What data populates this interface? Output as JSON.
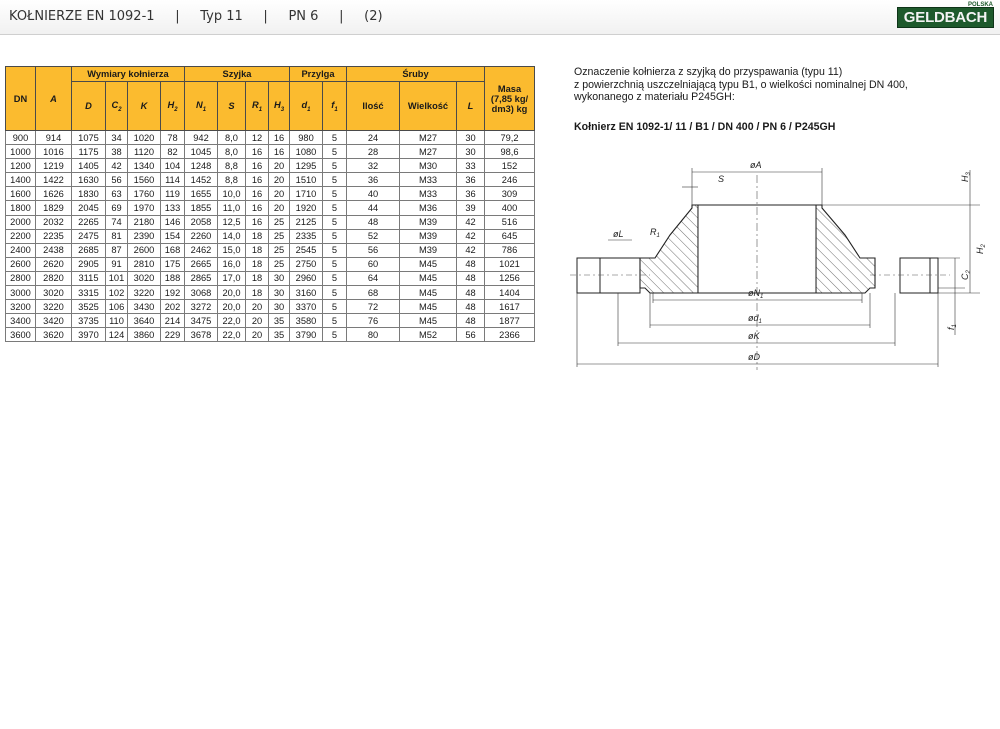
{
  "header": {
    "title": "KOŁNIERZE EN 1092-1     |     Typ 11     |     PN 6     |     (2)",
    "logo_text": "GELDBACH",
    "logo_small": "POLSKA"
  },
  "table": {
    "group_headers": {
      "dn": "DN",
      "flange": "Wymiary kołnierza",
      "neck": "Szyjka",
      "face": "Przylga",
      "bolts": "Śruby",
      "mass": "Masa (7,85 kg/ dm3) kg"
    },
    "symbols": {
      "a": "A",
      "d": "D",
      "c2": "C",
      "c2_sub": "2",
      "k": "K",
      "h2": "H",
      "h2_sub": "2",
      "n1": "N",
      "n1_sub": "1",
      "s": "S",
      "r1": "R",
      "r1_sub": "1",
      "h3": "H",
      "h3_sub": "3",
      "d1": "d",
      "d1_sub": "1",
      "f1": "f",
      "f1_sub": "1",
      "qty": "Ilość",
      "size": "Wielkość",
      "l": "L"
    },
    "rows": [
      [
        "900",
        "914",
        "1075",
        "34",
        "1020",
        "78",
        "942",
        "8,0",
        "12",
        "16",
        "980",
        "5",
        "24",
        "M27",
        "30",
        "79,2"
      ],
      [
        "1000",
        "1016",
        "1175",
        "38",
        "1120",
        "82",
        "1045",
        "8,0",
        "16",
        "16",
        "1080",
        "5",
        "28",
        "M27",
        "30",
        "98,6"
      ],
      [
        "1200",
        "1219",
        "1405",
        "42",
        "1340",
        "104",
        "1248",
        "8,8",
        "16",
        "20",
        "1295",
        "5",
        "32",
        "M30",
        "33",
        "152"
      ],
      [
        "1400",
        "1422",
        "1630",
        "56",
        "1560",
        "114",
        "1452",
        "8,8",
        "16",
        "20",
        "1510",
        "5",
        "36",
        "M33",
        "36",
        "246"
      ],
      [
        "1600",
        "1626",
        "1830",
        "63",
        "1760",
        "119",
        "1655",
        "10,0",
        "16",
        "20",
        "1710",
        "5",
        "40",
        "M33",
        "36",
        "309"
      ],
      [
        "1800",
        "1829",
        "2045",
        "69",
        "1970",
        "133",
        "1855",
        "11,0",
        "16",
        "20",
        "1920",
        "5",
        "44",
        "M36",
        "39",
        "400"
      ],
      [
        "2000",
        "2032",
        "2265",
        "74",
        "2180",
        "146",
        "2058",
        "12,5",
        "16",
        "25",
        "2125",
        "5",
        "48",
        "M39",
        "42",
        "516"
      ],
      [
        "2200",
        "2235",
        "2475",
        "81",
        "2390",
        "154",
        "2260",
        "14,0",
        "18",
        "25",
        "2335",
        "5",
        "52",
        "M39",
        "42",
        "645"
      ],
      [
        "2400",
        "2438",
        "2685",
        "87",
        "2600",
        "168",
        "2462",
        "15,0",
        "18",
        "25",
        "2545",
        "5",
        "56",
        "M39",
        "42",
        "786"
      ],
      [
        "2600",
        "2620",
        "2905",
        "91",
        "2810",
        "175",
        "2665",
        "16,0",
        "18",
        "25",
        "2750",
        "5",
        "60",
        "M45",
        "48",
        "1021"
      ],
      [
        "2800",
        "2820",
        "3115",
        "101",
        "3020",
        "188",
        "2865",
        "17,0",
        "18",
        "30",
        "2960",
        "5",
        "64",
        "M45",
        "48",
        "1256"
      ],
      [
        "3000",
        "3020",
        "3315",
        "102",
        "3220",
        "192",
        "3068",
        "20,0",
        "18",
        "30",
        "3160",
        "5",
        "68",
        "M45",
        "48",
        "1404"
      ],
      [
        "3200",
        "3220",
        "3525",
        "106",
        "3430",
        "202",
        "3272",
        "20,0",
        "20",
        "30",
        "3370",
        "5",
        "72",
        "M45",
        "48",
        "1617"
      ],
      [
        "3400",
        "3420",
        "3735",
        "110",
        "3640",
        "214",
        "3475",
        "22,0",
        "20",
        "35",
        "3580",
        "5",
        "76",
        "M45",
        "48",
        "1877"
      ],
      [
        "3600",
        "3620",
        "3970",
        "124",
        "3860",
        "229",
        "3678",
        "22,0",
        "20",
        "35",
        "3790",
        "5",
        "80",
        "M52",
        "56",
        "2366"
      ]
    ]
  },
  "description": {
    "line1": "Oznaczenie kołnierza z szyjką do przyspawania (typu 11)",
    "line2": "z powierzchnią uszczelniającą typu B1, o wielkości nominalnej DN 400,",
    "line3": "wykonanego z materiału P245GH:",
    "code": "Kołnierz EN 1092-1/ 11 / B1 / DN 400 / PN 6 / P245GH"
  },
  "drawing": {
    "dim_A": "øA",
    "dim_S": "S",
    "dim_L": "øL",
    "dim_R1": "R",
    "dim_R1_sub": "1",
    "dim_H3": "H",
    "dim_H3_sub": "3",
    "dim_H2": "H",
    "dim_H2_sub": "2",
    "dim_C2": "C",
    "dim_C2_sub": "2",
    "dim_f1": "f",
    "dim_f1_sub": "1",
    "dim_N1": "øN",
    "dim_N1_sub": "1",
    "dim_d1": "ød",
    "dim_d1_sub": "1",
    "dim_K": "øK",
    "dim_D": "øD"
  }
}
